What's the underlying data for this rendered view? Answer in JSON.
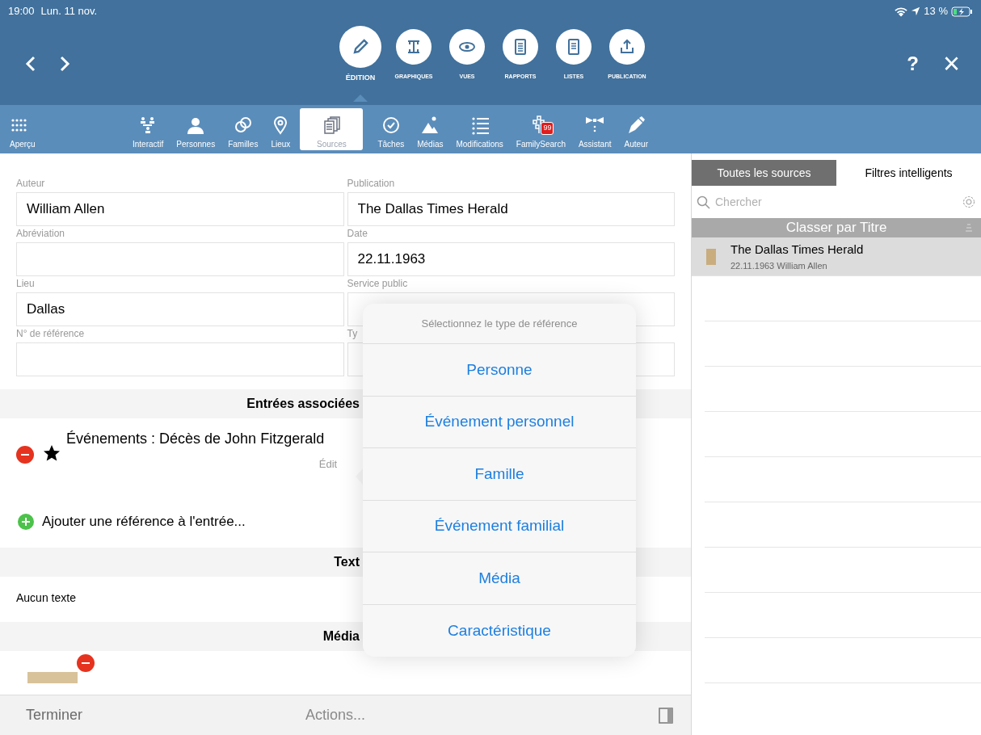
{
  "status_bar": {
    "time": "19:00",
    "date": "Lun. 11 nov.",
    "battery": "13 %"
  },
  "top_bar": {
    "help": "?",
    "close": "×",
    "modes": [
      {
        "label": "ÉDITION",
        "kind": "pencil",
        "selected": true
      },
      {
        "label": "GRAPHIQUES",
        "kind": "chart",
        "selected": false
      },
      {
        "label": "VUES",
        "kind": "eye",
        "selected": false
      },
      {
        "label": "RAPPORTS",
        "kind": "doc",
        "selected": false
      },
      {
        "label": "LISTES",
        "kind": "list",
        "selected": false
      },
      {
        "label": "PUBLICATION",
        "kind": "share",
        "selected": false
      }
    ]
  },
  "toolbar": [
    {
      "label": "Aperçu",
      "kind": "grid",
      "selected": false
    },
    {
      "label": "Interactif",
      "kind": "tree",
      "selected": false
    },
    {
      "label": "Personnes",
      "kind": "person",
      "selected": false
    },
    {
      "label": "Familles",
      "kind": "rings",
      "selected": false
    },
    {
      "label": "Lieux",
      "kind": "pin",
      "selected": false
    },
    {
      "label": "Sources",
      "kind": "pages",
      "selected": true
    },
    {
      "label": "Tâches",
      "kind": "check",
      "selected": false
    },
    {
      "label": "Médias",
      "kind": "mountain",
      "selected": false
    },
    {
      "label": "Modifications",
      "kind": "lines",
      "selected": false
    },
    {
      "label": "FamilySearch",
      "kind": "fstree",
      "selected": false,
      "badge": "99"
    },
    {
      "label": "Assistant",
      "kind": "bowtie",
      "selected": false
    },
    {
      "label": "Auteur",
      "kind": "pen",
      "selected": false
    }
  ],
  "form": {
    "fields": [
      {
        "label": "Auteur",
        "value": "William Allen"
      },
      {
        "label": "Publication",
        "value": "The Dallas Times Herald"
      },
      {
        "label": "Abréviation"
      },
      {
        "label": "Date",
        "value": "22.11.1963"
      },
      {
        "label": "Lieu",
        "value": "Dallas"
      },
      {
        "label": "Service public"
      },
      {
        "label": "N° de référence"
      },
      {
        "label": "Ty"
      }
    ],
    "sections": [
      {
        "kind": "entries",
        "title": "Entrées associées",
        "entry": "Événements : Décès de John Fitzgerald",
        "entry_note": "Édit",
        "add": "Ajouter une référence à l'entrée..."
      },
      {
        "kind": "text",
        "title": "Text",
        "body": "Aucun texte"
      },
      {
        "kind": "media",
        "title": "Média"
      }
    ]
  },
  "bottom_bar": {
    "done": "Terminer",
    "actions": "Actions..."
  },
  "sidebar": {
    "tabs": [
      {
        "label": "Toutes les sources",
        "selected": true
      },
      {
        "label": "Filtres intelligents",
        "selected": false
      }
    ],
    "search": {
      "placeholder": "Chercher"
    },
    "sort_header": "Classer par Titre",
    "items": [
      {
        "title": "The Dallas Times Herald",
        "subtitle": "22.11.1963 William Allen",
        "selected": true
      }
    ]
  },
  "popover": {
    "title": "Sélectionnez le type de référence",
    "options": [
      "Personne",
      "Événement personnel",
      "Famille",
      "Événement familial",
      "Média",
      "Caractéristique"
    ]
  }
}
